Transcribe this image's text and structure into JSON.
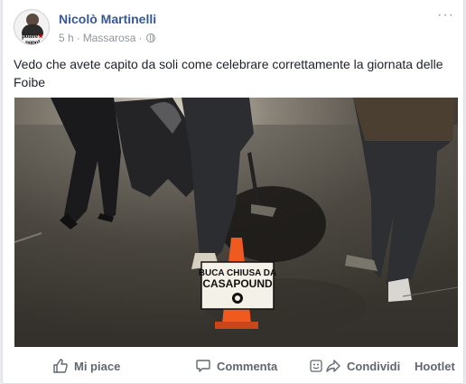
{
  "post": {
    "author": "Nicolò Martinelli",
    "avatar_text": "potere★\npopol",
    "time": "5 h",
    "separator": "·",
    "location": "Massarosa",
    "privacy_icon": "globe-icon",
    "more_label": "···",
    "text": "Vedo che avete capito da soli come celebrare correttamente la giornata delle Foibe",
    "photo": {
      "sign_line1": "BUCA CHIUSA DA",
      "sign_line2": "CASAPOUND"
    }
  },
  "actions": {
    "like_label": "Mi piace",
    "comment_label": "Commenta",
    "share_label": "Condividi",
    "hootlet_label": "Hootlet"
  },
  "colors": {
    "author_link": "#365899",
    "meta_gray": "#90949c",
    "action_gray": "#606770",
    "cone_orange": "#f05a1e"
  }
}
